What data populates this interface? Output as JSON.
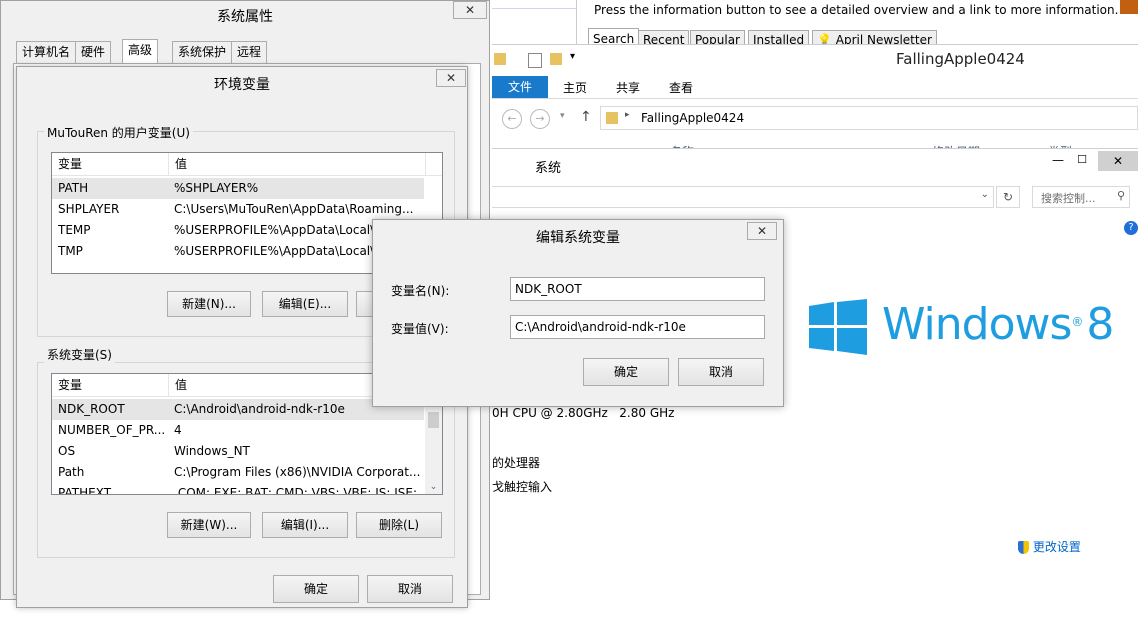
{
  "explorer": {
    "info_bar": "Press the information button to see a detailed overview and a link to more information.",
    "web_tabs": [
      "Search",
      "Recent",
      "Popular",
      "Installed",
      "April Newsletter"
    ],
    "window_title": "FallingApple0424",
    "ribbon_tabs": [
      "文件",
      "主页",
      "共享",
      "查看"
    ],
    "address_path": "FallingApple0424",
    "col_name": "名称",
    "col_date": "修改日期",
    "col_type": "类型"
  },
  "system_window": {
    "title": "系统",
    "search_placeholder": "搜索控制...",
    "brand": "Windows",
    "brand_version": "8",
    "cpu_text": "0H CPU @ 2.80GHz   2.80 GHz",
    "processor_text": "的处理器",
    "touch_text": "戈触控输入",
    "change_settings": "更改设置"
  },
  "sysprops": {
    "title": "系统属性",
    "tabs": [
      "计算机名",
      "硬件",
      "高级",
      "系统保护",
      "远程"
    ]
  },
  "envvars": {
    "title": "环境变量",
    "user_group": "MuTouRen 的用户变量(U)",
    "col_var": "变量",
    "col_val": "值",
    "user_vars": [
      {
        "name": "PATH",
        "value": "%SHPLAYER%"
      },
      {
        "name": "SHPLAYER",
        "value": "C:\\Users\\MuTouRen\\AppData\\Roaming..."
      },
      {
        "name": "TEMP",
        "value": "%USERPROFILE%\\AppData\\Local\\"
      },
      {
        "name": "TMP",
        "value": "%USERPROFILE%\\AppData\\Local\\"
      }
    ],
    "user_new": "新建(N)...",
    "user_edit": "编辑(E)...",
    "sys_group": "系统变量(S)",
    "sys_vars": [
      {
        "name": "NDK_ROOT",
        "value": "C:\\Android\\android-ndk-r10e"
      },
      {
        "name": "NUMBER_OF_PR...",
        "value": "4"
      },
      {
        "name": "OS",
        "value": "Windows_NT"
      },
      {
        "name": "Path",
        "value": "C:\\Program Files (x86)\\NVIDIA Corporat..."
      },
      {
        "name": "PATHEXT",
        "value": ".COM;.EXE;.BAT;.CMD;.VBS;.VBE;.JS;.JSE;..."
      }
    ],
    "sys_new": "新建(W)...",
    "sys_edit": "编辑(I)...",
    "sys_delete": "删除(L)",
    "ok": "确定",
    "cancel": "取消"
  },
  "editdlg": {
    "title": "编辑系统变量",
    "name_label": "变量名(N):",
    "name_value": "NDK_ROOT",
    "value_label": "变量值(V):",
    "value_value": "C:\\Android\\android-ndk-r10e",
    "ok": "确定",
    "cancel": "取消"
  },
  "colors": {
    "win8_blue": "#1e9ee0",
    "file_tab": "#1979ca",
    "dialog_bg": "#f0f0f0",
    "selection": "#e5e5e5"
  }
}
